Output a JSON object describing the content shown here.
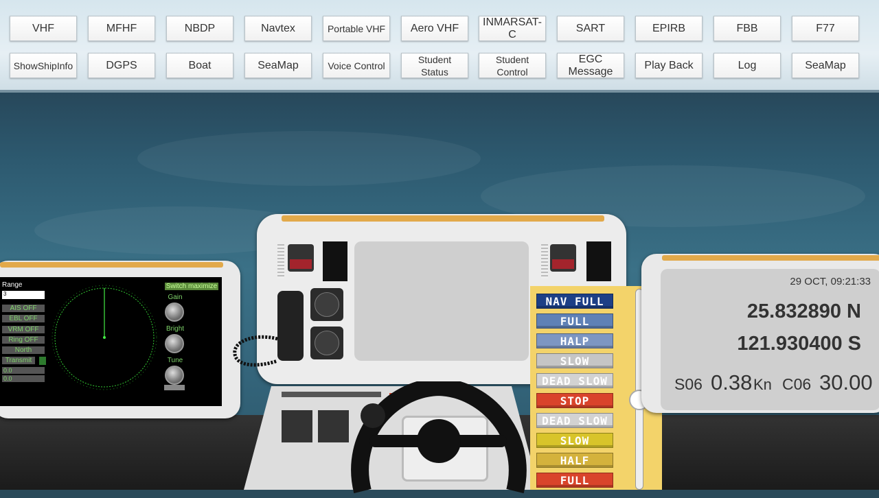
{
  "toolbar": {
    "row1": [
      "VHF",
      "MFHF",
      "NBDP",
      "Navtex",
      "Portable VHF",
      "Aero VHF",
      "INMARSAT-C",
      "SART",
      "EPIRB",
      "FBB",
      "F77"
    ],
    "row2": [
      "ShowShipInfo",
      "DGPS",
      "Boat",
      "SeaMap",
      "Voice Control",
      "Student\nStatus",
      "Student\nControl",
      "EGC\nMessage",
      "Play Back",
      "Log",
      "SeaMap"
    ]
  },
  "radar": {
    "range_label": "Range",
    "range_value": "3",
    "switch_label": "Switch maximize",
    "buttons": [
      "AIS OFF",
      "EBL OFF",
      "VRM OFF",
      "Ring OFF",
      "North",
      "Transmit"
    ],
    "values": [
      "0.0",
      "0.0"
    ],
    "knobs": [
      "Gain",
      "Bright",
      "Tune"
    ]
  },
  "telegraph": {
    "orders": [
      {
        "label": "NAV FULL",
        "color": "#1d3f86"
      },
      {
        "label": "FULL",
        "color": "#5f81b6"
      },
      {
        "label": "HALP",
        "color": "#7d96c2"
      },
      {
        "label": "SLOW",
        "color": "#c5c5c5"
      },
      {
        "label": "DEAD SLOW",
        "color": "#d2d2d2"
      },
      {
        "label": "STOP",
        "color": "#d9442b"
      },
      {
        "label": "DEAD SLOW",
        "color": "#d2d2d2"
      },
      {
        "label": "SLOW",
        "color": "#d8c42a"
      },
      {
        "label": "HALF",
        "color": "#d4b23c"
      },
      {
        "label": "FULL",
        "color": "#d9442b"
      }
    ]
  },
  "info": {
    "datetime": "29 OCT,  09:21:33",
    "latitude": "25.832890 N",
    "longitude": "121.930400 S",
    "speed_label": "S06",
    "speed_value": "0.38",
    "speed_unit": "Kn",
    "course_label": "C06",
    "course_value": "30.00"
  }
}
